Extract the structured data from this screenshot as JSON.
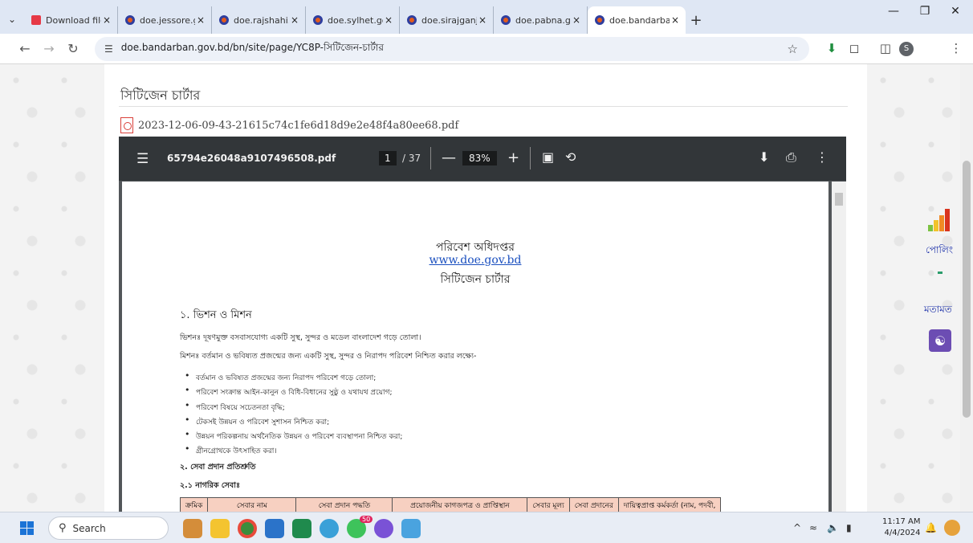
{
  "browser": {
    "tabs": [
      {
        "label": "Download file",
        "icon": "heart-icon",
        "color": "#e63946",
        "active": false
      },
      {
        "label": "doe.jessore.g",
        "icon": "doe-favicon",
        "color": "#e35b1c",
        "active": false
      },
      {
        "label": "doe.rajshahi.g",
        "icon": "doe-favicon",
        "color": "#e35b1c",
        "active": false
      },
      {
        "label": "doe.sylhet.gov",
        "icon": "doe-favicon",
        "color": "#e35b1c",
        "active": false
      },
      {
        "label": "doe.sirajganj.",
        "icon": "doe-favicon",
        "color": "#e35b1c",
        "active": false
      },
      {
        "label": "doe.pabna.go",
        "icon": "doe-favicon",
        "color": "#e35b1c",
        "active": false
      },
      {
        "label": "doe.bandarba",
        "icon": "doe-favicon",
        "color": "#e35b1c",
        "active": true
      }
    ],
    "url": "doe.bandarban.gov.bd/bn/site/page/YC8P-সিটিজেন-চার্টার"
  },
  "page": {
    "heading": "সিটিজেন চার্টার",
    "pdf_filename": "2023-12-06-09-43-21615c74c1fe6d18d9e2e48f4a80ee68.pdf",
    "side_poll": "পোলিং",
    "side_feedback": "মতামত"
  },
  "viewer": {
    "file_name": "65794e26048a9107496508.pdf",
    "current_page": "1",
    "total_pages": "/ 37",
    "zoom": "83%"
  },
  "document": {
    "org": "পরিবেশ অধিদপ্তর",
    "website": "www.doe.gov.bd",
    "title": "সিটিজেন চার্টার",
    "section1": "১. ভিশন ও মিশন",
    "vision": "ভিশনঃ দূষণমুক্ত বসবাসযোগ্য একটি সুস্থ, সুন্দর ও মডেল বাংলাদেশ গড়ে তোলা।",
    "mission": "মিশনঃ বর্তমান ও ভবিষ্যত প্রজন্মের জন্য একটি সুস্থ, সুন্দর ও নিরাপদ পরিবেশ নিশ্চিত করার লক্ষ্যে-",
    "bullets": [
      "বর্তমান ও ভবিষ্যত প্রজন্মের জন্য নিরাপদ পরিবেশ গড়ে তোলা;",
      "পরিবেশ সংক্রান্ত আইন-কানুন ও বিধি-বিধানের সুষ্ঠু ও যথাযথ প্রয়োগ;",
      "পরিবেশ বিষয়ে সচেতনতা বৃদ্ধি;",
      "টেকসই উন্নয়ন ও পরিবেশ সুশাসন নিশ্চিত করা;",
      "উন্নয়ন পরিকল্পনায় অর্থনৈতিক উন্নয়ন ও পরিবেশ ব্যবস্থাপনা নিশ্চিত করা;",
      "গ্রীনগ্রোথকে উৎসাহিত করা।"
    ],
    "section2": "২. সেবা প্রদান প্রতিশ্রুতি",
    "section21": "২.১ নাগরিক সেবাঃ",
    "table_headers": [
      "ক্রমিক",
      "সেবার নাম",
      "সেবা প্রদান পদ্ধতি",
      "প্রয়োজনীয় কাগজপত্র ও প্রাপ্তিস্থান",
      "সেবার মূল্য",
      "সেবা প্রদানের",
      "দায়িত্বপ্রাপ্ত কর্মকর্তা (নাম, পদবী,"
    ]
  },
  "taskbar": {
    "search_placeholder": "Search",
    "time": "11:17 AM",
    "date": "4/4/2024",
    "chat_badge": "50"
  }
}
